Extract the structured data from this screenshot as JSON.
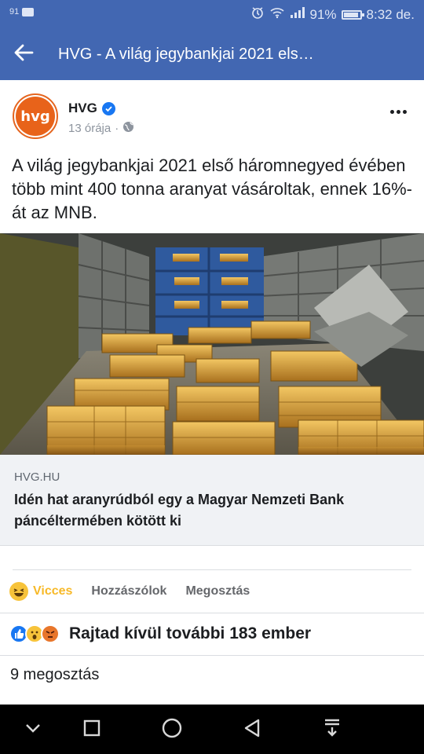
{
  "status_bar": {
    "left_text": "91",
    "battery_percent": "91%",
    "time": "8:32 de."
  },
  "header": {
    "title": "HVG - A világ jegybankjai 2021 els…",
    "back_icon": "arrow-left-icon"
  },
  "post": {
    "page_name": "HVG",
    "avatar_text": "hvg",
    "time_ago": "13 órája",
    "separator": "·",
    "text": "A világ jegybankjai 2021 első háromnegyed évében több mint 400 tonna aranyat vásároltak, ennek 16%-át az MNB."
  },
  "link": {
    "domain": "HVG.HU",
    "title": "Idén hat aranyrúdból egy a Magyar Nemzeti Bank páncéltermében kötött ki"
  },
  "actions": [
    {
      "label": "Vicces",
      "active": true
    },
    {
      "label": "Hozzászólok",
      "active": false
    },
    {
      "label": "Megosztás",
      "active": false
    }
  ],
  "reactions": {
    "summary": "Rajtad kívül további 183 ember"
  },
  "shares": "9 megosztás",
  "colors": {
    "brand_blue": "#4267b2",
    "hvg_orange": "#e8631a",
    "active_reaction": "#f7b928"
  }
}
